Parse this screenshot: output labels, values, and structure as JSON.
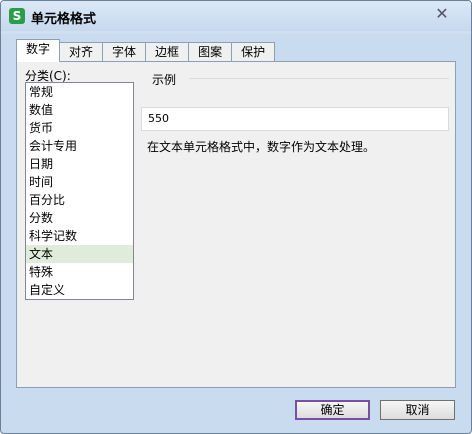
{
  "window": {
    "title": "单元格格式",
    "app_icon_glyph": "S",
    "close_glyph": "✕"
  },
  "tabs": [
    {
      "label": "数字",
      "active": true
    },
    {
      "label": "对齐",
      "active": false
    },
    {
      "label": "字体",
      "active": false
    },
    {
      "label": "边框",
      "active": false
    },
    {
      "label": "图案",
      "active": false
    },
    {
      "label": "保护",
      "active": false
    }
  ],
  "category": {
    "label": "分类(C):",
    "items": [
      "常规",
      "数值",
      "货币",
      "会计专用",
      "日期",
      "时间",
      "百分比",
      "分数",
      "科学记数",
      "文本",
      "特殊",
      "自定义"
    ],
    "selected": "文本"
  },
  "sample": {
    "label": "示例",
    "value": "550"
  },
  "description": "在文本单元格格式中，数字作为文本处理。",
  "buttons": {
    "ok": "确定",
    "cancel": "取消"
  },
  "colors": {
    "selected_item_bg": "#dfecd9",
    "focus_border": "#7a4fa3",
    "app_icon_bg": "#2a9d4a"
  }
}
